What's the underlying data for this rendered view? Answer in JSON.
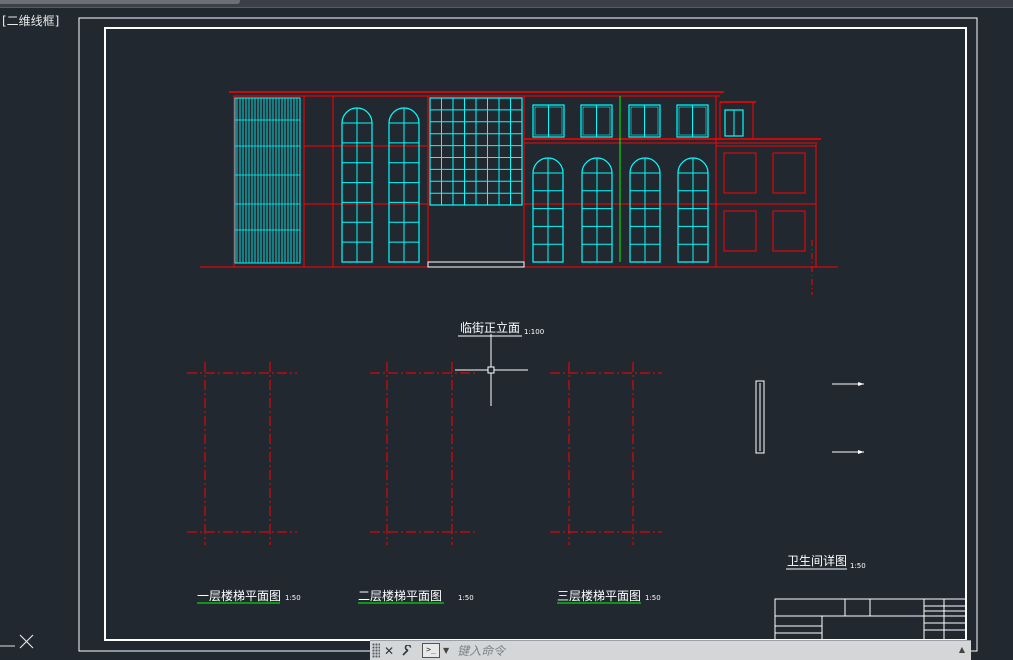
{
  "viewport": {
    "label": "[二维线框]"
  },
  "drawing": {
    "elevation_title": "临街正立面",
    "elevation_scale": "1:100",
    "stair_plans": [
      {
        "title": "一层楼梯平面图",
        "scale": "1:50"
      },
      {
        "title": "二层楼梯平面图",
        "scale": "1:50"
      },
      {
        "title": "三层楼梯平面图",
        "scale": "1:50"
      }
    ],
    "bathroom_title": "卫生间详图",
    "bathroom_scale": "1:50"
  },
  "command_line": {
    "placeholder": "键入命令",
    "close_icon": "close-icon",
    "customize_icon": "wrench-icon",
    "prompt_icon": "command-prompt-icon"
  },
  "colors": {
    "background": "#212830",
    "red": "#ff0000",
    "cyan": "#00ffff",
    "white": "#ffffff",
    "green": "#00ff00"
  }
}
